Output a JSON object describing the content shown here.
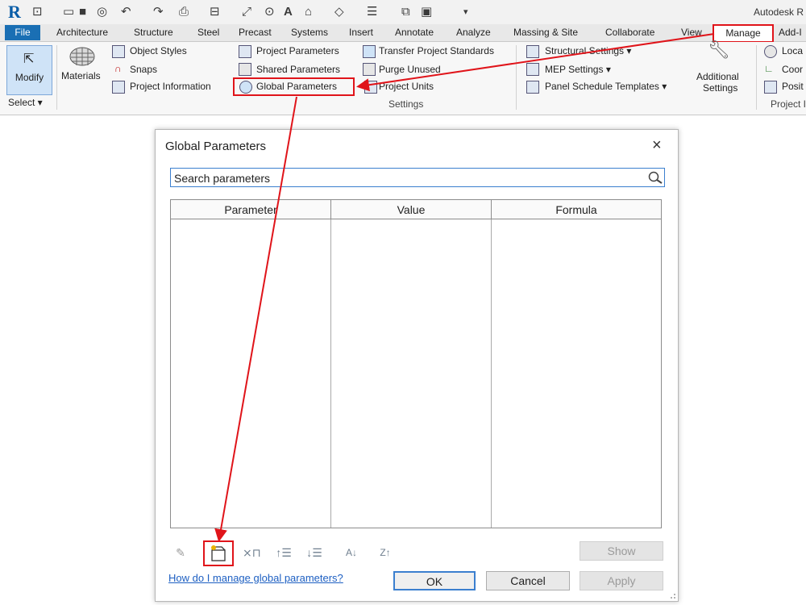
{
  "app": {
    "logo": "R",
    "title": "Autodesk R"
  },
  "tabs": [
    "File",
    "Architecture",
    "Structure",
    "Steel",
    "Precast",
    "Systems",
    "Insert",
    "Annotate",
    "Analyze",
    "Massing & Site",
    "Collaborate",
    "View",
    "Manage",
    "Add-I"
  ],
  "ribbon": {
    "modify": "Modify",
    "select": "Select ▾",
    "materials": "Materials",
    "col1": [
      "Object Styles",
      "Snaps",
      "Project Information"
    ],
    "col2": [
      "Project Parameters",
      "Shared Parameters",
      "Global Parameters"
    ],
    "col3": [
      "Transfer Project Standards",
      "Purge Unused",
      "Project Units"
    ],
    "col4": [
      "Structural Settings ▾",
      "MEP Settings ▾",
      "Panel Schedule Templates ▾"
    ],
    "additional": [
      "Additional",
      "Settings"
    ],
    "col5": [
      "Loca",
      "Coor",
      "Posit"
    ],
    "settings_panel": "Settings",
    "project_panel": "Project I"
  },
  "dialog": {
    "title": "Global Parameters",
    "close": "×",
    "search_placeholder": "Search parameters",
    "columns": [
      "Parameter",
      "Value",
      "Formula"
    ],
    "help_link": "How do I manage global parameters?",
    "buttons": {
      "show": "Show",
      "ok": "OK",
      "cancel": "Cancel",
      "apply": "Apply"
    }
  },
  "colors": {
    "annotation": "#e0141a",
    "file_tab": "#1a6fb4",
    "link": "#1d5fc2"
  }
}
